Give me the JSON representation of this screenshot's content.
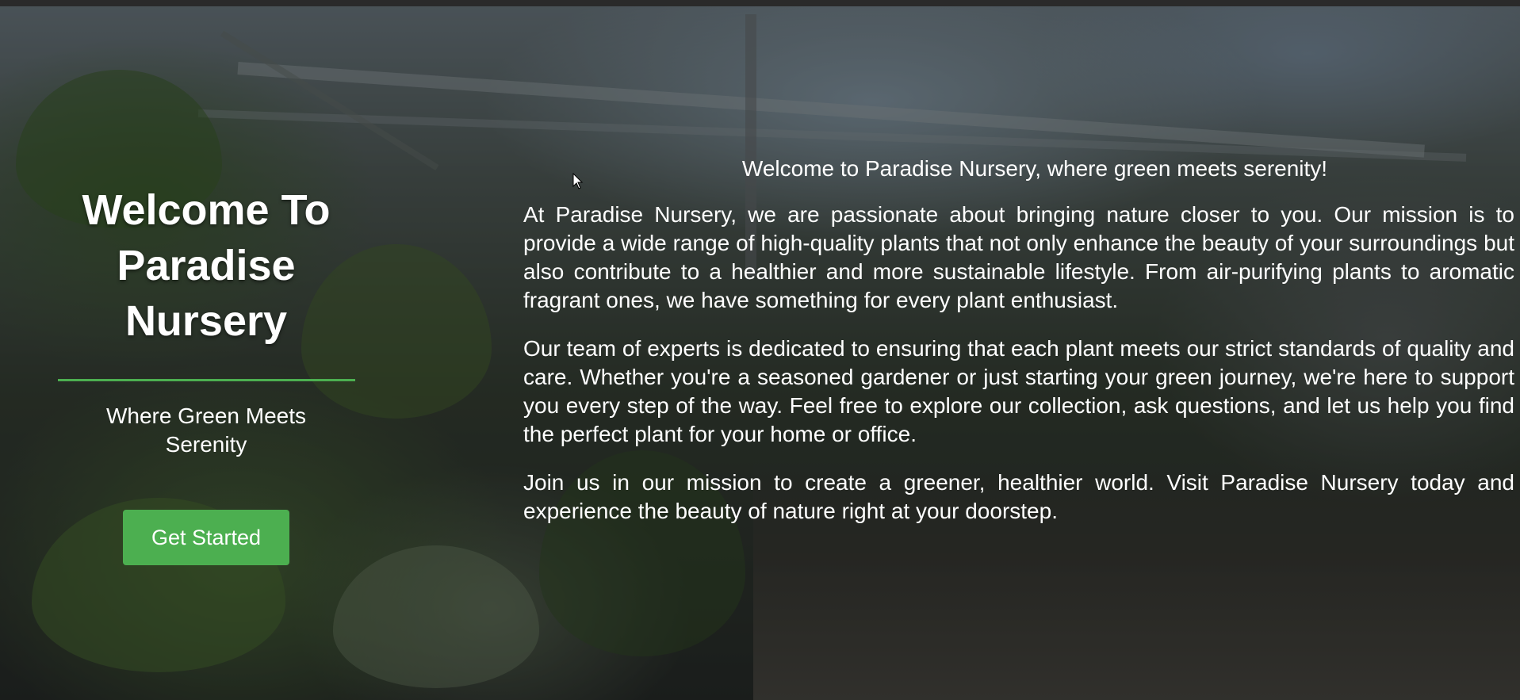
{
  "hero": {
    "title_line1": "Welcome To",
    "title_line2": "Paradise",
    "title_line3": "Nursery",
    "subtitle": "Where Green Meets Serenity",
    "cta_label": "Get Started"
  },
  "about": {
    "lead": "Welcome to Paradise Nursery, where green meets serenity!",
    "paragraphs": [
      "At Paradise Nursery, we are passionate about bringing nature closer to you. Our mission is to provide a wide range of high-quality plants that not only enhance the beauty of your surroundings but also contribute to a healthier and more sustainable lifestyle. From air-purifying plants to aromatic fragrant ones, we have something for every plant enthusiast.",
      "Our team of experts is dedicated to ensuring that each plant meets our strict standards of quality and care. Whether you're a seasoned gardener or just starting your green journey, we're here to support you every step of the way. Feel free to explore our collection, ask questions, and let us help you find the perfect plant for your home or office.",
      "Join us in our mission to create a greener, healthier world. Visit Paradise Nursery today and experience the beauty of nature right at your doorstep."
    ]
  },
  "colors": {
    "accent": "#4caf50",
    "text": "#ffffff",
    "overlay": "rgba(0,0,0,0.42)"
  },
  "icons": {
    "cursor": "mouse-pointer-icon"
  }
}
